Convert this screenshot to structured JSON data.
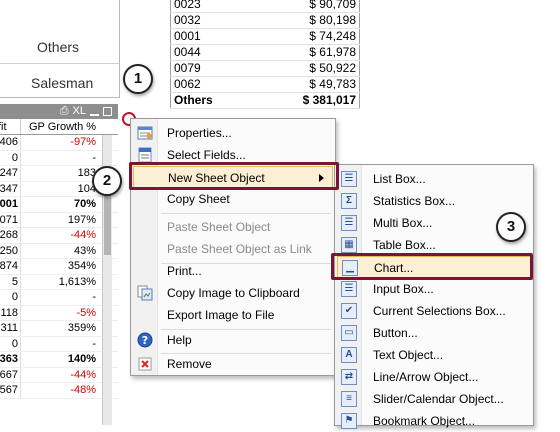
{
  "pie_chart": {
    "others_label": "Others",
    "dimension_label": "Salesman"
  },
  "top_table": {
    "rows": [
      {
        "id": "0023",
        "amount": "$ 90,709"
      },
      {
        "id": "0032",
        "amount": "$ 80,198"
      },
      {
        "id": "0001",
        "amount": "$ 74,248"
      },
      {
        "id": "0044",
        "amount": "$ 61,978"
      },
      {
        "id": "0079",
        "amount": "$ 50,922"
      },
      {
        "id": "0062",
        "amount": "$ 49,783"
      }
    ],
    "total_label": "Others",
    "total_amount": "$ 381,017"
  },
  "growth_table": {
    "titlebar_text": "XL",
    "header_profit": "fit",
    "header_growth": "GP Growth %",
    "rows": [
      {
        "profit": "406",
        "growth": "-97%",
        "negative": true,
        "bold": false
      },
      {
        "profit": "0",
        "growth": "-",
        "negative": false,
        "bold": false
      },
      {
        "profit": "247",
        "growth": "183",
        "negative": false,
        "bold": false
      },
      {
        "profit": "347",
        "growth": "104",
        "negative": false,
        "bold": false
      },
      {
        "profit": "001",
        "growth": "70%",
        "negative": false,
        "bold": true
      },
      {
        "profit": "071",
        "growth": "197%",
        "negative": false,
        "bold": false
      },
      {
        "profit": "268",
        "growth": "-44%",
        "negative": true,
        "bold": false
      },
      {
        "profit": "250",
        "growth": "43%",
        "negative": false,
        "bold": false
      },
      {
        "profit": "874",
        "growth": "354%",
        "negative": false,
        "bold": false
      },
      {
        "profit": "5",
        "growth": "1,613%",
        "negative": false,
        "bold": false
      },
      {
        "profit": "0",
        "growth": "-",
        "negative": false,
        "bold": false
      },
      {
        "profit": "118",
        "growth": "-5%",
        "negative": true,
        "bold": false
      },
      {
        "profit": "311",
        "growth": "359%",
        "negative": false,
        "bold": false
      },
      {
        "profit": "0",
        "growth": "-",
        "negative": false,
        "bold": false
      },
      {
        "profit": "363",
        "growth": "140%",
        "negative": false,
        "bold": true
      },
      {
        "profit": "667",
        "growth": "-44%",
        "negative": true,
        "bold": false
      },
      {
        "profit": "567",
        "growth": "-48%",
        "negative": true,
        "bold": false
      }
    ]
  },
  "context_menu": {
    "properties": "Properties...",
    "select_fields": "Select Fields...",
    "new_sheet_object": "New Sheet Object",
    "copy_sheet": "Copy Sheet",
    "paste_sheet_object": "Paste Sheet Object",
    "paste_sheet_object_link": "Paste Sheet Object as Link",
    "print": "Print...",
    "copy_image": "Copy Image to Clipboard",
    "export_image": "Export Image to File",
    "help": "Help",
    "remove": "Remove"
  },
  "submenu": {
    "items": [
      "List Box...",
      "Statistics Box...",
      "Multi Box...",
      "Table Box...",
      "Chart...",
      "Input Box...",
      "Current Selections Box...",
      "Button...",
      "Text Object...",
      "Line/Arrow Object...",
      "Slider/Calendar Object...",
      "Bookmark Object..."
    ]
  },
  "callouts": {
    "step1": "1",
    "step2": "2",
    "step3": "3"
  },
  "colors": {
    "highlight_border": "#7b1535",
    "menu_hover": "#fcefd3",
    "negative_text": "#d40000"
  }
}
